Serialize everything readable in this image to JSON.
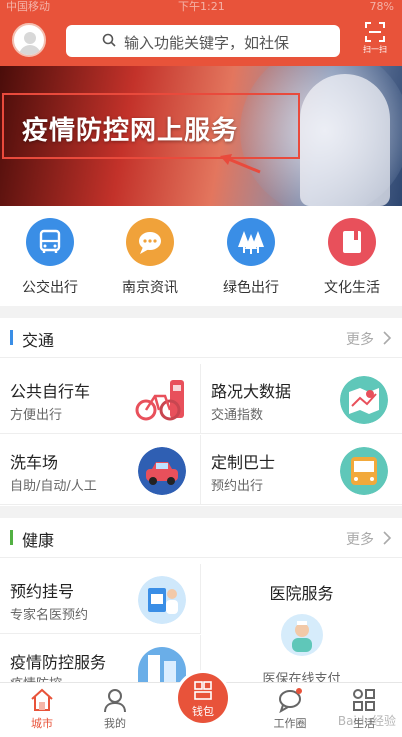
{
  "status": {
    "carrier": "中国移动",
    "time": "下午1:21",
    "battery": "78%"
  },
  "header": {
    "search_placeholder": "输入功能关键字，如社保",
    "scan_label": "扫一扫"
  },
  "banner": {
    "title": "疫情防控网上服务"
  },
  "quick_links": [
    {
      "label": "公交出行",
      "icon": "bus-icon",
      "color": "#3a8ee6"
    },
    {
      "label": "南京资讯",
      "icon": "chat-bubble-icon",
      "color": "#f0a23a"
    },
    {
      "label": "绿色出行",
      "icon": "trees-icon",
      "color": "#3a8ee6"
    },
    {
      "label": "文化生活",
      "icon": "book-icon",
      "color": "#e8505b"
    }
  ],
  "traffic": {
    "title": "交通",
    "more": "更多",
    "accent": "#3a8ee6",
    "tiles": [
      {
        "title": "公共自行车",
        "subtitle": "方便出行",
        "icon": "bicycle-icon"
      },
      {
        "title": "路况大数据",
        "subtitle": "交通指数",
        "icon": "map-icon"
      },
      {
        "title": "洗车场",
        "subtitle": "自助/自动/人工",
        "icon": "car-wash-icon"
      },
      {
        "title": "定制巴士",
        "subtitle": "预约出行",
        "icon": "bus-icon"
      }
    ]
  },
  "health": {
    "title": "健康",
    "more": "更多",
    "accent": "#52b043",
    "tiles": [
      {
        "title": "预约挂号",
        "subtitle": "专家名医预约",
        "icon": "doctor-icon"
      },
      {
        "title": "疫情防控服务",
        "subtitle": "疫情防控",
        "icon": "building-icon"
      }
    ],
    "side": {
      "title": "医院服务",
      "subtitle": "医保在线支付",
      "icon": "nurse-icon"
    }
  },
  "tabs": [
    {
      "label": "城市",
      "icon": "home-icon",
      "active": true
    },
    {
      "label": "我的",
      "icon": "person-icon",
      "active": false
    },
    {
      "label": "钱包",
      "icon": "wallet-icon",
      "active": false
    },
    {
      "label": "工作圈",
      "icon": "chat-icon",
      "active": false
    },
    {
      "label": "生活",
      "icon": "grid-icon",
      "active": false
    }
  ],
  "watermark": "Baidu经验"
}
